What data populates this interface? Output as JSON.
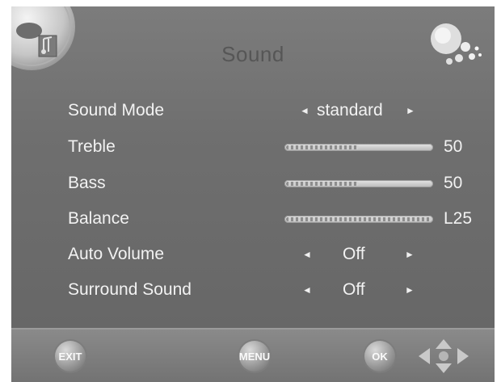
{
  "header": {
    "title": "Sound"
  },
  "colors": {
    "panel": "#6e6e6e",
    "text": "#f2f2f2",
    "title": "#565656"
  },
  "items": [
    {
      "kind": "select",
      "label": "Sound Mode",
      "value": "standard"
    },
    {
      "kind": "slider",
      "label": "Treble",
      "value": "50",
      "level": 0.5
    },
    {
      "kind": "slider",
      "label": "Bass",
      "value": "50",
      "level": 0.5
    },
    {
      "kind": "slider",
      "label": "Balance",
      "value": "L25",
      "level": 1.0
    },
    {
      "kind": "select",
      "label": "Auto Volume",
      "value": "Off"
    },
    {
      "kind": "select",
      "label": "Surround Sound",
      "value": "Off"
    }
  ],
  "footer": {
    "exit_label": "EXIT",
    "menu_label": "MENU",
    "ok_label": "OK"
  },
  "icons": {
    "menu_icon": "sound-menu-icon",
    "decoration": "bubbles-decoration-icon",
    "left_arrow": "◄",
    "right_arrow": "►",
    "nav": "navigation-arrows-icon"
  }
}
